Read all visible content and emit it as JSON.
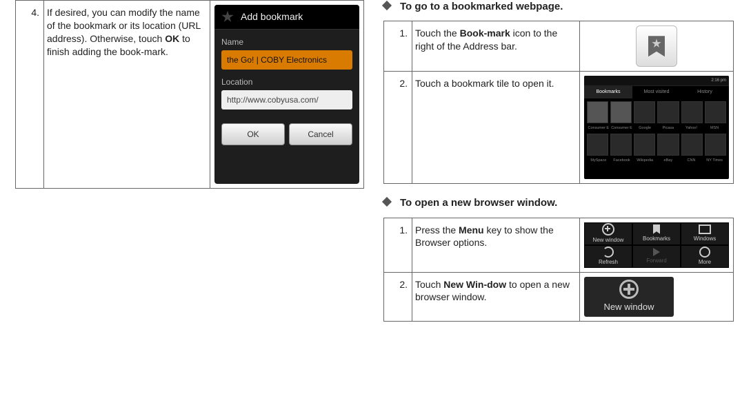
{
  "left": {
    "step4": {
      "num": "4.",
      "text_before_bold": "If desired, you can modify the name of the bookmark or its location (URL address). Otherwise, touch ",
      "bold": "OK",
      "text_after_bold": " to finish adding the book-mark."
    },
    "dialog": {
      "title": "Add bookmark",
      "name_label": "Name",
      "name_value": "the Go! | COBY Electronics",
      "location_label": "Location",
      "location_value": "http://www.cobyusa.com/",
      "ok": "OK",
      "cancel": "Cancel"
    }
  },
  "right": {
    "section1_title": "To go to a bookmarked webpage.",
    "s1": {
      "step1_num": "1.",
      "step1_a": "Touch the ",
      "step1_b": "Book-mark",
      "step1_c": " icon to the right of the Address bar.",
      "step2_num": "2.",
      "step2_text": "Touch a bookmark tile to open it."
    },
    "bmgrid": {
      "status_time": "2:16 pm",
      "tabs": [
        "Bookmarks",
        "Most visited",
        "History"
      ],
      "row1": [
        "Consumer E",
        "Consumer E",
        "Google",
        "Picasa",
        "Yahoo!",
        "MSN"
      ],
      "row2": [
        "MySpace",
        "Facebook",
        "Wikipedia",
        "eBay",
        "CNN",
        "NY Times"
      ]
    },
    "section2_title": "To open a new browser window.",
    "s2": {
      "step1_num": "1.",
      "step1_a": "Press the ",
      "step1_b": "Menu",
      "step1_c": " key to show the Browser options.",
      "step2_num": "2.",
      "step2_a": "Touch ",
      "step2_b": "New Win-dow",
      "step2_c": " to open a new browser window."
    },
    "menu": {
      "items": [
        "New window",
        "Bookmarks",
        "Windows",
        "Refresh",
        "Forward",
        "More"
      ]
    },
    "newwin_label": "New window"
  }
}
